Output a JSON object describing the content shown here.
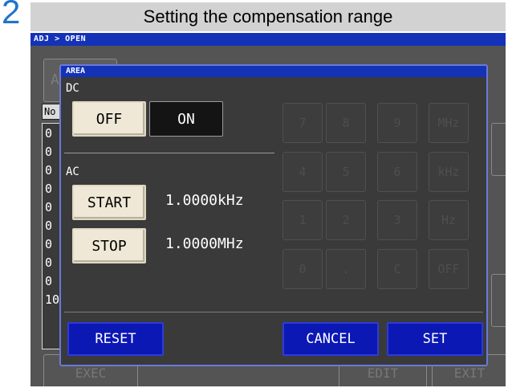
{
  "step": {
    "number": "2",
    "title": "Setting the compensation range"
  },
  "breadcrumb": "ADJ > OPEN",
  "background": {
    "area_button": "A",
    "list_header": "No",
    "list_items": [
      "0",
      "0",
      "0",
      "0",
      "0",
      "0",
      "0",
      "0",
      "0",
      "10"
    ],
    "exec_button": "EXEC",
    "edit_button": "EDIT",
    "exit_button": "EXIT"
  },
  "dialog": {
    "title": "AREA",
    "dc": {
      "label": "DC",
      "off_label": "OFF",
      "on_label": "ON",
      "selected": "ON"
    },
    "ac": {
      "label": "AC",
      "start_label": "START",
      "start_value": "1.0000kHz",
      "stop_label": "STOP",
      "stop_value": "1.0000MHz"
    },
    "keypad": [
      "7",
      "8",
      "9",
      "MHz",
      "4",
      "5",
      "6",
      "kHz",
      "1",
      "2",
      "3",
      "Hz",
      "0",
      ".",
      "C",
      "OFF"
    ],
    "reset_label": "RESET",
    "cancel_label": "CANCEL",
    "set_label": "SET"
  },
  "colors": {
    "accent_blue": "#1432b8",
    "button_blue": "#0c18b4",
    "button_cream": "#efe8d6",
    "step_number": "#1f74c8"
  }
}
